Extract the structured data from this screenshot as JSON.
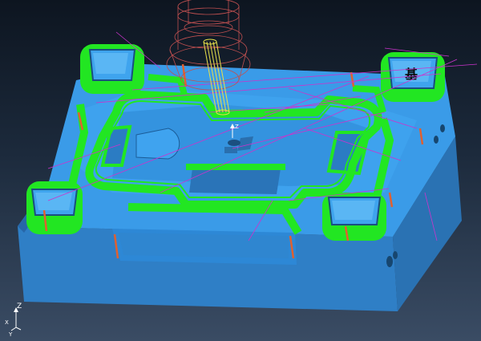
{
  "viewport": {
    "background_top": "#0d1520",
    "background_bottom": "#3a4c64"
  },
  "colors": {
    "part_top": "#3a9be8",
    "part_side_front": "#2f7fc6",
    "part_side_right": "#2a72b3",
    "toolpath_green": "#22e622",
    "toolpath_magenta": "#cc33cc",
    "tool_yellow": "#e8e04a",
    "tool_holder": "#c05050",
    "cut_face_orange": "#e06030"
  },
  "scene": {
    "insert_marking": "基",
    "tool_axis_label": "Z"
  },
  "triad": {
    "z_label": "Z",
    "x_label": "X",
    "y_label": "Y"
  }
}
